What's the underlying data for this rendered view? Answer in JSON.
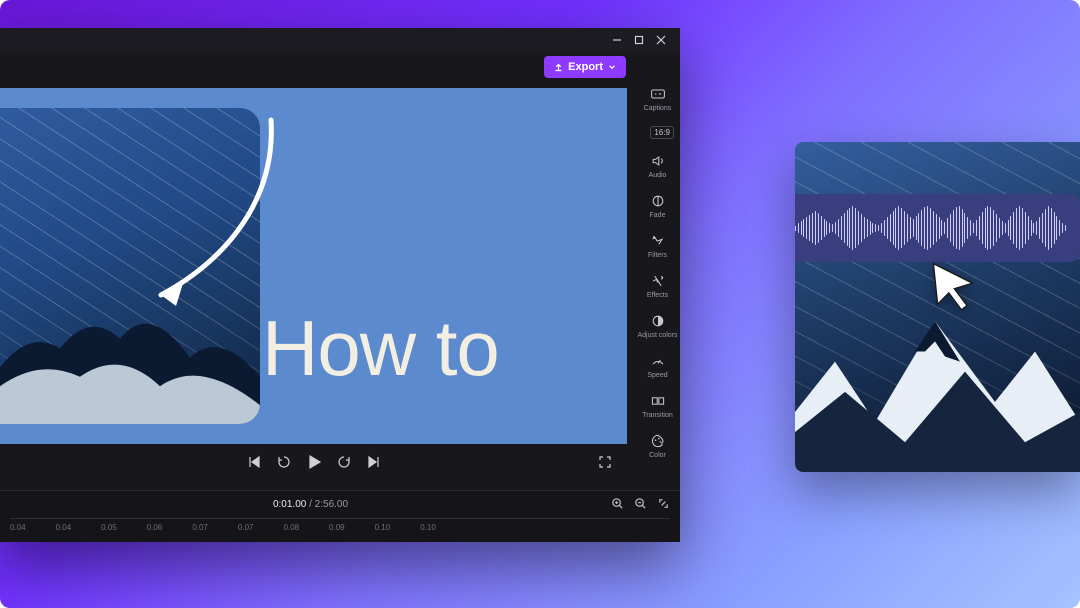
{
  "window_controls": {
    "minimize": "minimize",
    "maximize": "maximize",
    "close": "close"
  },
  "toolbar": {
    "export_label": "Export",
    "aspect_ratio": "16:9"
  },
  "sidebar": {
    "items": [
      {
        "id": "captions",
        "label": "Captions"
      },
      {
        "id": "audio",
        "label": "Audio"
      },
      {
        "id": "fade",
        "label": "Fade"
      },
      {
        "id": "filters",
        "label": "Filters"
      },
      {
        "id": "effects",
        "label": "Effects"
      },
      {
        "id": "adjust",
        "label": "Adjust colors"
      },
      {
        "id": "speed",
        "label": "Speed"
      },
      {
        "id": "transition",
        "label": "Transition"
      },
      {
        "id": "color",
        "label": "Color"
      }
    ]
  },
  "canvas": {
    "overlay_text": "How to"
  },
  "playback": {
    "current_time": "0:01.00",
    "total_time": "2:56.00",
    "separator": " / "
  },
  "ruler_ticks": [
    "0.04",
    "0.04",
    "0.05",
    "0.06",
    "0.07",
    "0.07",
    "0.08",
    "0.09",
    "0.10",
    "0.10"
  ],
  "colors": {
    "accent": "#8f3bff",
    "canvas_bg": "#5b8acf"
  },
  "promo": {
    "audio_waveform_bars": [
      6,
      8,
      5,
      10,
      14,
      18,
      22,
      26,
      30,
      34,
      30,
      24,
      18,
      14,
      10,
      8,
      12,
      18,
      24,
      30,
      36,
      40,
      44,
      40,
      34,
      28,
      22,
      18,
      14,
      10,
      8,
      6,
      10,
      16,
      22,
      28,
      34,
      40,
      44,
      40,
      34,
      28,
      22,
      18,
      24,
      30,
      36,
      42,
      44,
      40,
      34,
      28,
      22,
      16,
      12,
      20,
      28,
      36,
      42,
      44,
      38,
      30,
      22,
      16,
      10,
      16,
      24,
      32,
      40,
      44,
      42,
      36,
      28,
      20,
      14,
      10,
      16,
      24,
      32,
      40,
      44,
      40,
      32,
      24,
      16,
      10,
      14,
      22,
      30,
      38,
      44,
      40,
      32,
      24,
      16,
      10,
      6
    ]
  }
}
